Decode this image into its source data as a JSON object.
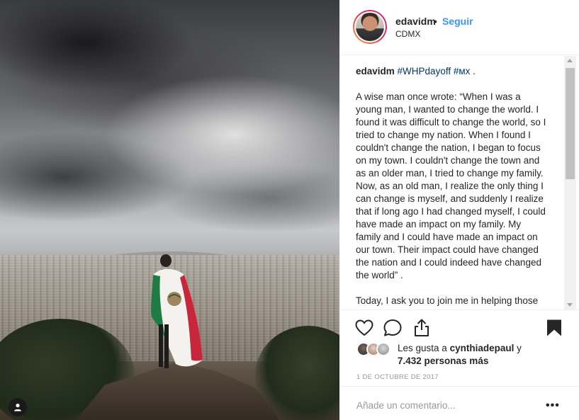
{
  "post": {
    "username": "edavidm",
    "separator": "•",
    "follow_label": "Seguir",
    "location": "CDMX"
  },
  "caption": {
    "username": "edavidm",
    "hashtag_1": "#WHPdayoff",
    "hashtag_2": "#мх",
    "trail": " .",
    "body": "A wise man once wrote: “When I was a young man, I wanted to change the world. I found it was difficult to change the world, so I tried to change my nation. When I found I couldn't change the nation, I began to focus on my town. I couldn't change the town and as an older man, I tried to change my family. Now, as an old man, I realize the only thing I can change is myself, and suddenly I realize that if long ago I had changed myself, I could have made an impact on my family. My family and I could have made an impact on our town. Their impact could have changed the nation and I could indeed have changed the world” .",
    "body_2": "Today, I ask you to join me in helping those less fortunate. Mexican families affected by"
  },
  "likes": {
    "prefix": "Les gusta a ",
    "user": "cynthiadepaul",
    "joiner": " y",
    "count_text": "7.432 personas más"
  },
  "date": "1 DE OCTUBRE DE 2017",
  "comment": {
    "placeholder": "Añade un comentario...",
    "more_label": "•••"
  },
  "icons": {
    "like": "heart-icon",
    "comment": "comment-bubble-icon",
    "share": "share-icon",
    "save": "bookmark-icon",
    "tag": "user-tag-icon"
  },
  "colors": {
    "follow": "#3897f0",
    "hashtag": "#003569",
    "muted": "#999999",
    "story_ring": [
      "#f9a23b",
      "#e0365f",
      "#b72e99"
    ]
  }
}
